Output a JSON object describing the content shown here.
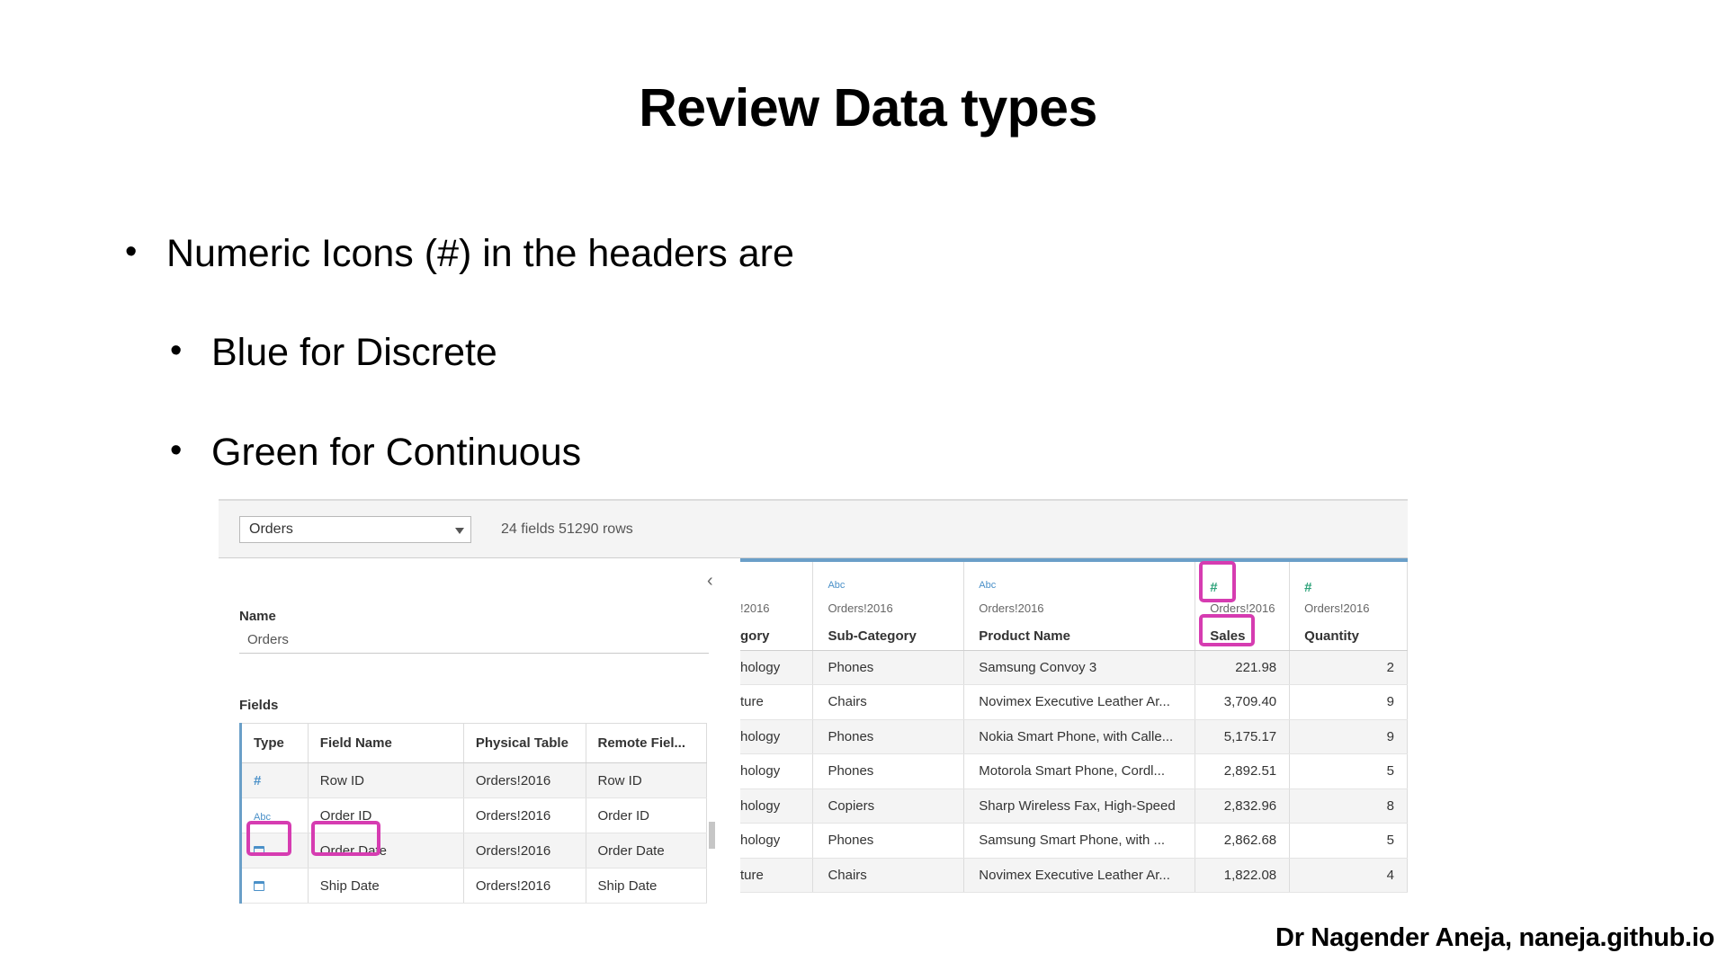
{
  "slide": {
    "title": "Review Data types",
    "bullets": [
      "Numeric Icons (#) in the headers are",
      "Blue for Discrete",
      "Green for Continuous"
    ],
    "footer": "Dr Nagender Aneja, naneja.github.io"
  },
  "screenshot": {
    "datasource": {
      "selected": "Orders",
      "info": "24 fields 51290 rows"
    },
    "left_panel": {
      "name_label": "Name",
      "name_value": "Orders",
      "fields_label": "Fields",
      "columns": [
        "Type",
        "Field Name",
        "Physical Table",
        "Remote Fiel..."
      ],
      "rows": [
        {
          "type_icon": "hash-icon",
          "type_glyph": "#",
          "field": "Row ID",
          "table": "Orders!2016",
          "remote": "Row ID"
        },
        {
          "type_icon": "abc-icon",
          "type_glyph": "Abc",
          "field": "Order ID",
          "table": "Orders!2016",
          "remote": "Order ID"
        },
        {
          "type_icon": "calendar-icon",
          "type_glyph": "",
          "field": "Order Date",
          "table": "Orders!2016",
          "remote": "Order Date"
        },
        {
          "type_icon": "calendar-icon",
          "type_glyph": "",
          "field": "Ship Date",
          "table": "Orders!2016",
          "remote": "Ship Date"
        }
      ]
    },
    "grid": {
      "columns": [
        {
          "icon": "",
          "source": "!2016",
          "name": "gory"
        },
        {
          "icon": "Abc",
          "source": "Orders!2016",
          "name": "Sub-Category"
        },
        {
          "icon": "Abc",
          "source": "Orders!2016",
          "name": "Product Name"
        },
        {
          "icon": "#",
          "source": "Orders!2016",
          "name": "Sales"
        },
        {
          "icon": "#",
          "source": "Orders!2016",
          "name": "Quantity"
        }
      ],
      "rows": [
        [
          "hology",
          "Phones",
          "Samsung Convoy 3",
          "221.98",
          "2"
        ],
        [
          "ture",
          "Chairs",
          "Novimex Executive Leather Ar...",
          "3,709.40",
          "9"
        ],
        [
          "hology",
          "Phones",
          "Nokia Smart Phone, with Calle...",
          "5,175.17",
          "9"
        ],
        [
          "hology",
          "Phones",
          "Motorola Smart Phone, Cordl...",
          "2,892.51",
          "5"
        ],
        [
          "hology",
          "Copiers",
          "Sharp Wireless Fax, High-Speed",
          "2,832.96",
          "8"
        ],
        [
          "hology",
          "Phones",
          "Samsung Smart Phone, with ...",
          "2,862.68",
          "5"
        ],
        [
          "ture",
          "Chairs",
          "Novimex Executive Leather Ar...",
          "1,822.08",
          "4"
        ]
      ]
    },
    "colors": {
      "highlight": "#d63cb1",
      "discrete_blue": "#4a90c8",
      "continuous_green": "#2ea37a"
    }
  }
}
